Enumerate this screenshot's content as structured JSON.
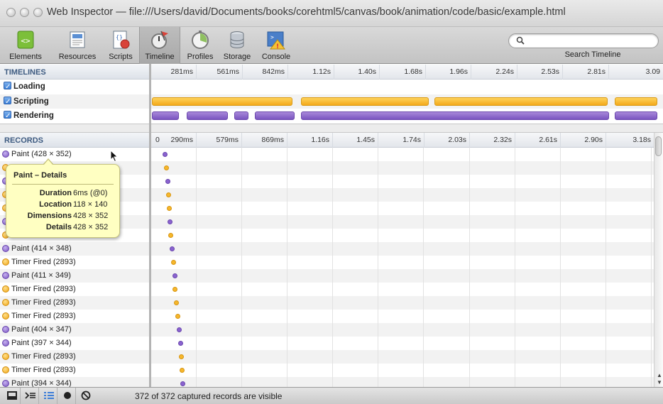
{
  "window": {
    "title": "Web Inspector — file:///Users/david/Documents/books/corehtml5/canvas/book/animation/code/basic/example.html"
  },
  "toolbar": {
    "items": [
      {
        "label": "Elements",
        "icon": "elements-icon"
      },
      {
        "label": "Resources",
        "icon": "resources-icon"
      },
      {
        "label": "Scripts",
        "icon": "scripts-icon"
      },
      {
        "label": "Timeline",
        "icon": "timeline-icon",
        "selected": true
      },
      {
        "label": "Profiles",
        "icon": "profiles-icon"
      },
      {
        "label": "Storage",
        "icon": "storage-icon"
      },
      {
        "label": "Console",
        "icon": "console-icon"
      }
    ],
    "search_label": "Search Timeline",
    "search_value": ""
  },
  "timelines": {
    "header": "TIMELINES",
    "ticks": [
      "281ms",
      "561ms",
      "842ms",
      "1.12s",
      "1.40s",
      "1.68s",
      "1.96s",
      "2.24s",
      "2.53s",
      "2.81s",
      "3.09"
    ],
    "rows": [
      {
        "label": "Loading",
        "checked": true
      },
      {
        "label": "Scripting",
        "checked": true,
        "color": "#f3a91b"
      },
      {
        "label": "Rendering",
        "checked": true,
        "color": "#7a55c0"
      }
    ]
  },
  "records": {
    "header": "RECORDS",
    "ticks": [
      "0",
      "290ms",
      "579ms",
      "869ms",
      "1.16s",
      "1.45s",
      "1.74s",
      "2.03s",
      "2.32s",
      "2.61s",
      "2.90s",
      "3.18s"
    ],
    "items": [
      {
        "label": "Paint (428 × 352)",
        "type": "paint"
      },
      {
        "label": "Timer Fired (2893)",
        "type": "timer"
      },
      {
        "label": "",
        "type": "paint"
      },
      {
        "label": "",
        "type": "timer"
      },
      {
        "label": "",
        "type": "timer"
      },
      {
        "label": "",
        "type": "paint"
      },
      {
        "label": "",
        "type": "timer"
      },
      {
        "label": "Paint (414 × 348)",
        "type": "paint"
      },
      {
        "label": "Timer Fired (2893)",
        "type": "timer"
      },
      {
        "label": "Paint (411 × 349)",
        "type": "paint"
      },
      {
        "label": "Timer Fired (2893)",
        "type": "timer"
      },
      {
        "label": "Timer Fired (2893)",
        "type": "timer"
      },
      {
        "label": "Timer Fired (2893)",
        "type": "timer"
      },
      {
        "label": "Paint (404 × 347)",
        "type": "paint"
      },
      {
        "label": "Paint (397 × 344)",
        "type": "paint"
      },
      {
        "label": "Timer Fired (2893)",
        "type": "timer"
      },
      {
        "label": "Timer Fired (2893)",
        "type": "timer"
      },
      {
        "label": "Paint (394 × 344)",
        "type": "paint"
      }
    ]
  },
  "tooltip": {
    "title": "Paint – Details",
    "rows": [
      {
        "key": "Duration",
        "value": "6ms (@0)"
      },
      {
        "key": "Location",
        "value": "118 × 140"
      },
      {
        "key": "Dimensions",
        "value": "428 × 352"
      },
      {
        "key": "Details",
        "value": "428 × 352"
      }
    ]
  },
  "statusbar": {
    "text": "372 of 372 captured records are visible",
    "buttons": [
      "dock-icon",
      "console-toggle-icon",
      "overview-icon",
      "record-icon",
      "clear-icon"
    ]
  },
  "colors": {
    "scripting": "#f3a91b",
    "rendering": "#7a55c0",
    "header_text": "#3d5a80"
  }
}
